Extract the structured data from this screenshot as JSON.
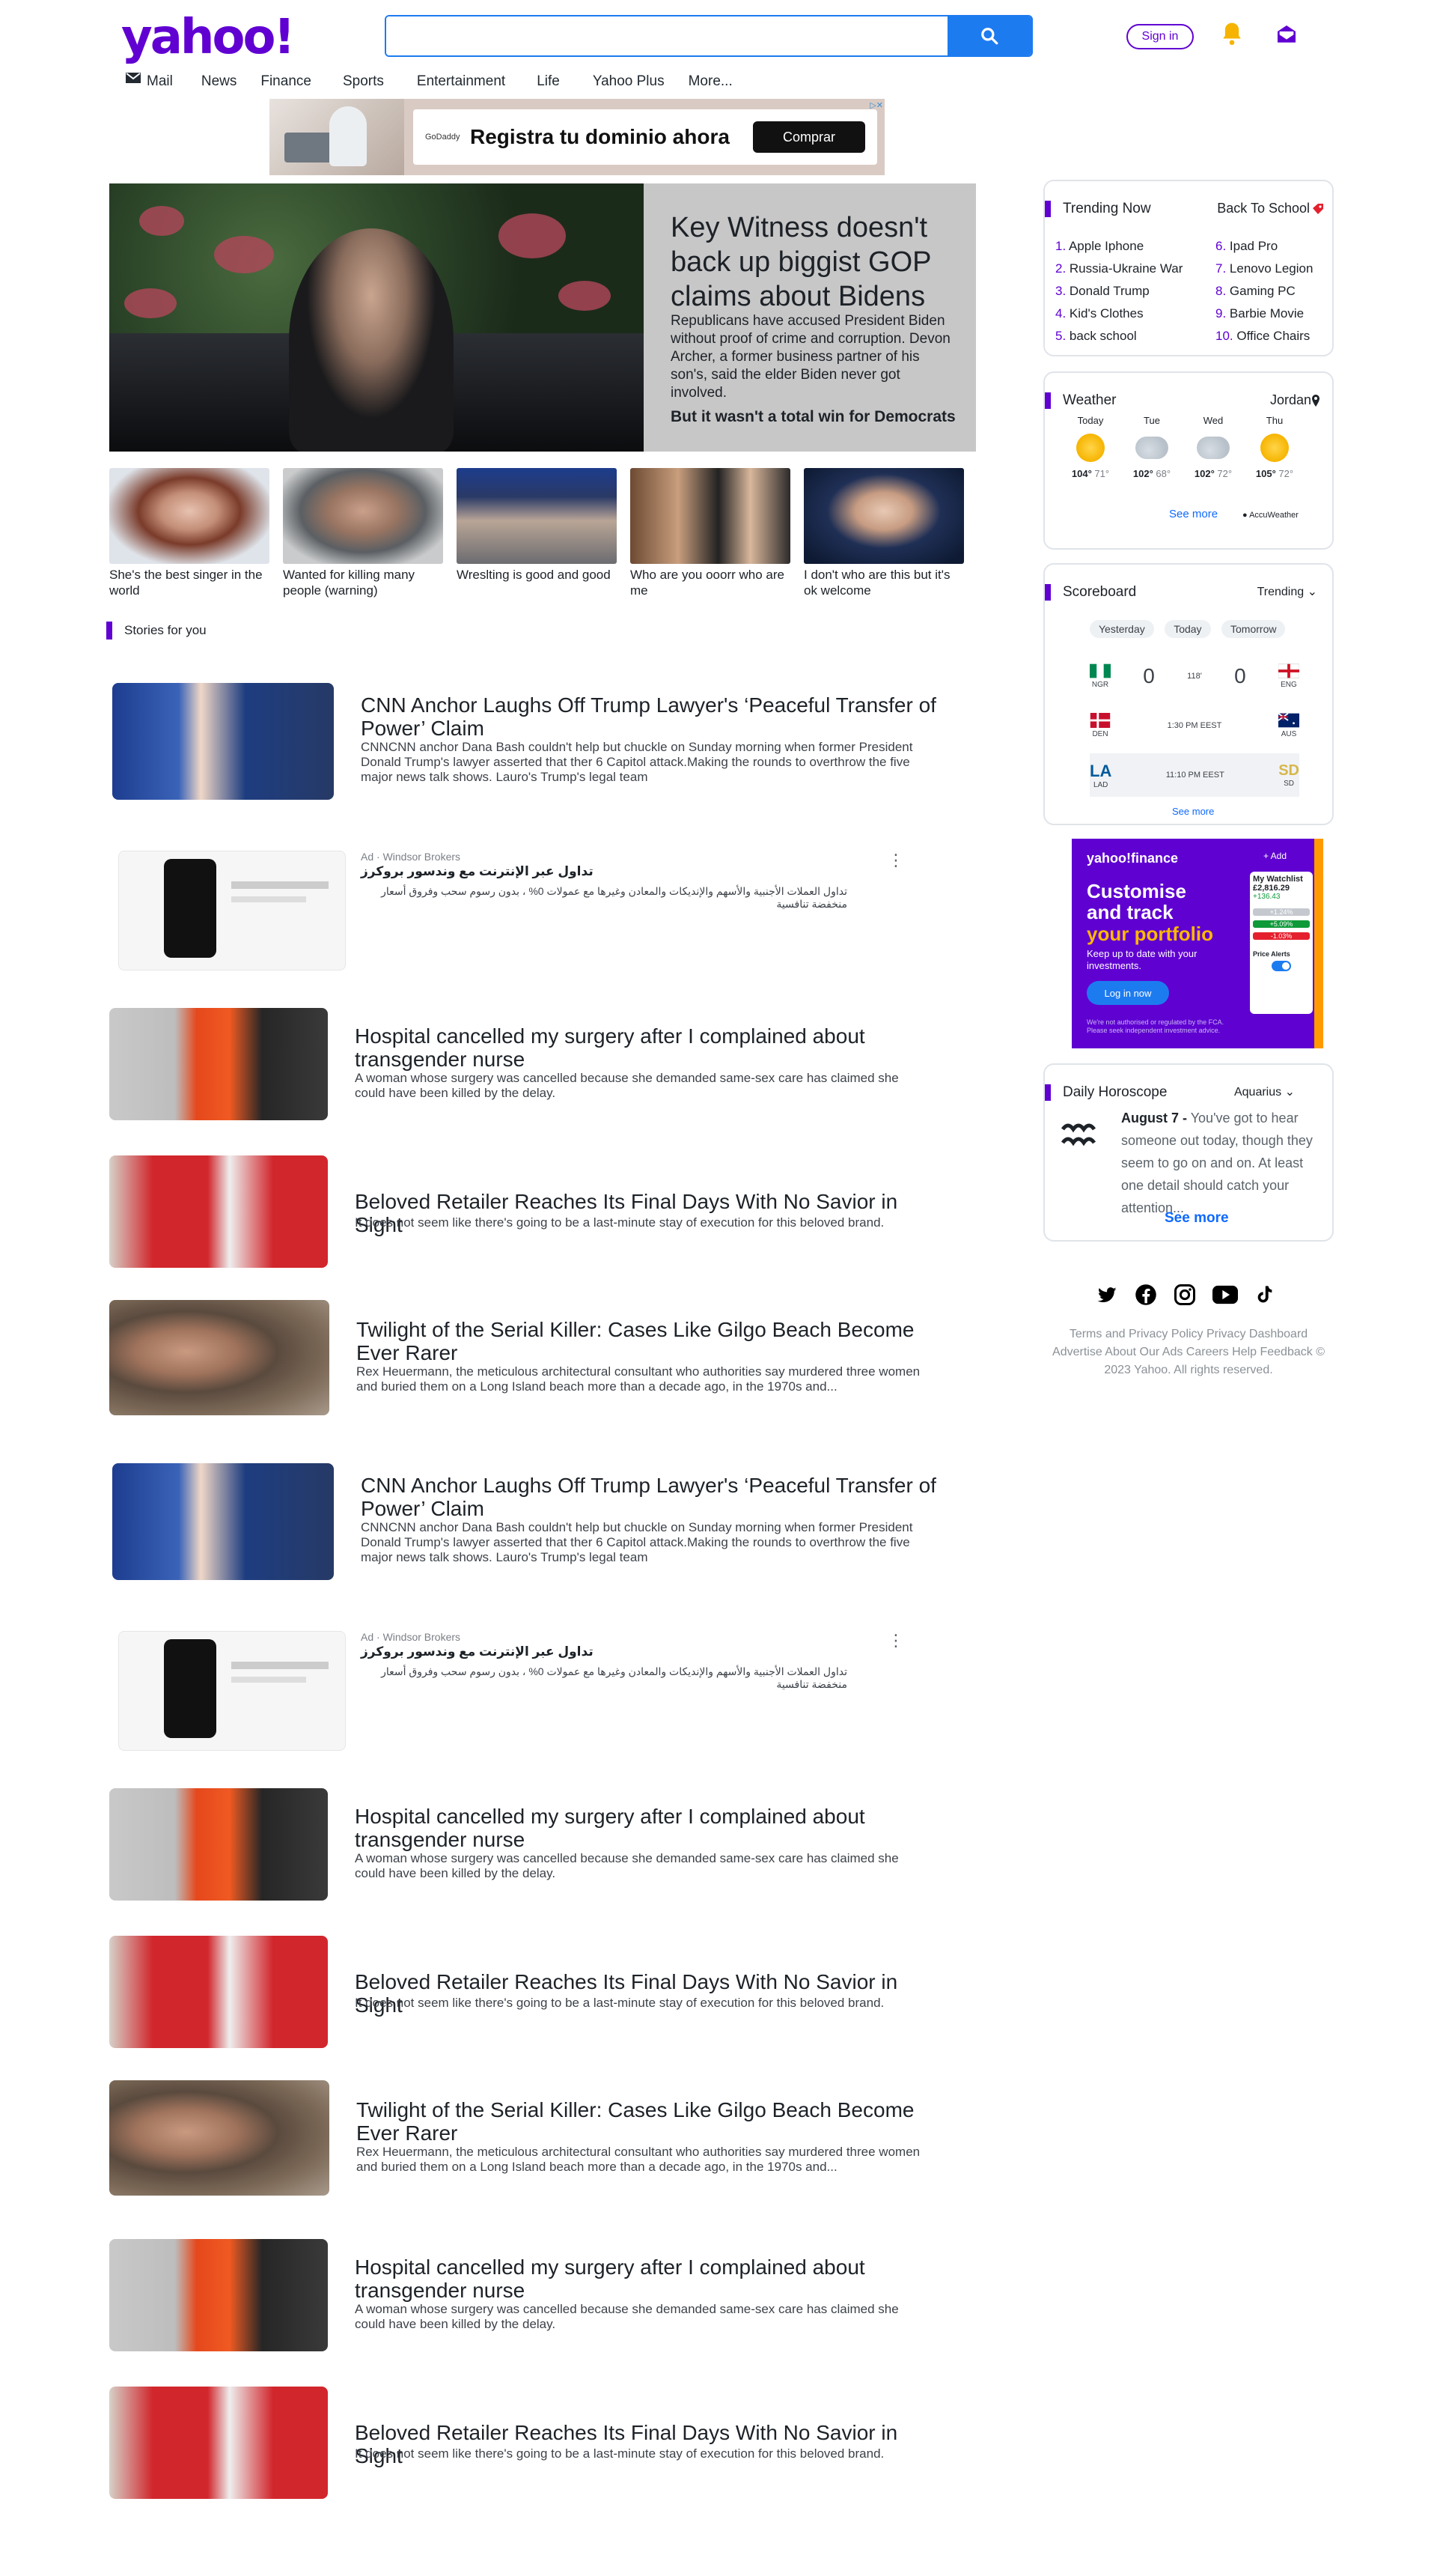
{
  "header": {
    "logo": "yahoo!",
    "search_placeholder": "",
    "signin_label": "Sign in",
    "nav": [
      "Mail",
      "News",
      "Finance",
      "Sports",
      "Entertainment",
      "Life",
      "Yahoo Plus",
      "More..."
    ]
  },
  "ad_banner": {
    "text": "Registra tu dominio ahora",
    "button": "Comprar",
    "brand": "GoDaddy"
  },
  "hero": {
    "title": "Key Witness doesn't back up biggist GOP claims about Bidens",
    "description": "Republicans have accused President Biden without proof of crime and corruption. Devon Archer, a former business partner of his son's, said the elder Biden never got involved.",
    "subhead": "But it wasn't a total win for Democrats"
  },
  "thumbs": [
    {
      "caption": "She's the best singer in the world"
    },
    {
      "caption": "Wanted for killing many people (warning)"
    },
    {
      "caption": "Wreslting is good and good"
    },
    {
      "caption": "Who are you ooorr who are me"
    },
    {
      "caption": "I don't who are this but it's ok welcome"
    }
  ],
  "stories_label": "Stories for you",
  "stories": [
    {
      "kind": "news",
      "title": "CNN Anchor Laughs Off Trump Lawyer's ‘Peaceful Transfer of Power’ Claim",
      "desc": "CNNCNN anchor Dana Bash couldn't help but chuckle on Sunday morning when former President Donald Trump's lawyer asserted that ther 6 Capitol attack.Making the rounds to overthrow the five major news talk shows. Lauro's Trump's legal team"
    },
    {
      "kind": "ad",
      "meta": "Ad · Windsor Brokers",
      "title": "تداول عبر الإنترنت مع وندسور بروكرز",
      "desc": "تداول العملات الأجنبية والأسهم والإنديكات والمعادن وغيرها مع عمولات 0% ، بدون رسوم سحب وفروق أسعار منخفضة تنافسية"
    },
    {
      "kind": "news",
      "title": "Hospital cancelled my surgery after I complained about transgender nurse",
      "desc": "A woman whose surgery was cancelled because she demanded same-sex care has claimed she could have been killed by the delay."
    },
    {
      "kind": "news",
      "title": "Beloved Retailer Reaches Its Final Days With No Savior in Sight",
      "desc": "It does not seem like there's going to be a last-minute stay of execution for this beloved brand."
    },
    {
      "kind": "news",
      "title": "Twilight of the Serial Killer: Cases Like Gilgo Beach Become Ever Rarer",
      "desc": "Rex Heuermann, the meticulous architectural consultant who authorities say murdered three women and buried them on a Long Island beach more than a decade ago, in the 1970s and..."
    },
    {
      "kind": "news",
      "title": "CNN Anchor Laughs Off Trump Lawyer's ‘Peaceful Transfer of Power’ Claim",
      "desc": "CNNCNN anchor Dana Bash couldn't help but chuckle on Sunday morning when former President Donald Trump's lawyer asserted that ther 6 Capitol attack.Making the rounds to overthrow the five major news talk shows. Lauro's Trump's legal team"
    },
    {
      "kind": "ad",
      "meta": "Ad · Windsor Brokers",
      "title": "تداول عبر الإنترنت مع وندسور بروكرز",
      "desc": "تداول العملات الأجنبية والأسهم والإنديكات والمعادن وغيرها مع عمولات 0% ، بدون رسوم سحب وفروق أسعار منخفضة تنافسية"
    },
    {
      "kind": "news",
      "title": "Hospital cancelled my surgery after I complained about transgender nurse",
      "desc": "A woman whose surgery was cancelled because she demanded same-sex care has claimed she could have been killed by the delay."
    },
    {
      "kind": "news",
      "title": "Beloved Retailer Reaches Its Final Days With No Savior in Sight",
      "desc": "It does not seem like there's going to be a last-minute stay of execution for this beloved brand."
    },
    {
      "kind": "news",
      "title": "Twilight of the Serial Killer: Cases Like Gilgo Beach Become Ever Rarer",
      "desc": "Rex Heuermann, the meticulous architectural consultant who authorities say murdered three women and buried them on a Long Island beach more than a decade ago, in the 1970s and..."
    },
    {
      "kind": "news",
      "title": "Hospital cancelled my surgery after I complained about transgender nurse",
      "desc": "A woman whose surgery was cancelled because she demanded same-sex care has claimed she could have been killed by the delay."
    },
    {
      "kind": "news",
      "title": "Beloved Retailer Reaches Its Final Days With No Savior in Sight",
      "desc": "It does not seem like there's going to be a last-minute stay of execution for this beloved brand."
    }
  ],
  "trending": {
    "title": "Trending Now",
    "link": "Back To School",
    "left": [
      "Apple Iphone",
      "Russia-Ukraine War",
      "Donald Trump",
      "Kid's Clothes",
      "back school"
    ],
    "right": [
      "Ipad Pro",
      "Lenovo Legion",
      "Gaming PC",
      "Barbie Movie",
      "Office Chairs"
    ]
  },
  "weather": {
    "title": "Weather",
    "location": "Jordan",
    "days": [
      {
        "name": "Today",
        "hi": "104°",
        "lo": "71°",
        "icon": "sun"
      },
      {
        "name": "Tue",
        "hi": "102°",
        "lo": "68°",
        "icon": "cloud"
      },
      {
        "name": "Wed",
        "hi": "102°",
        "lo": "72°",
        "icon": "cloud"
      },
      {
        "name": "Thu",
        "hi": "105°",
        "lo": "72°",
        "icon": "sun"
      }
    ],
    "see_more": "See more",
    "provider": "AccuWeather"
  },
  "scoreboard": {
    "title": "Scoreboard",
    "filter": "Trending",
    "tabs": [
      "Yesterday",
      "Today",
      "Tomorrow"
    ],
    "rows": [
      {
        "home": "NGR",
        "away": "ENG",
        "home_score": "0",
        "away_score": "0",
        "status": "118'"
      },
      {
        "home": "DEN",
        "away": "AUS",
        "home_score": "",
        "away_score": "",
        "status": "1:30 PM EEST"
      },
      {
        "home": "LAD",
        "away": "SD",
        "home_score": "",
        "away_score": "",
        "status": "11:10 PM EEST"
      }
    ],
    "see_more": "See more"
  },
  "finance_ad": {
    "brand": "yahoo!finance",
    "headline_1": "Customise and track",
    "headline_2": "your portfolio",
    "body": "Keep up to date with your investments.",
    "cta": "Log in now",
    "add": "+ Add",
    "watchlist": "My Watchlist",
    "value": "£2,816.29",
    "change": "+136.43",
    "badges": [
      "+1.24%",
      "+5.09%",
      "-1.03%"
    ],
    "price_alerts": "Price Alerts",
    "disclaimer": "We're not authorised or regulated by the FCA. Please seek independent investment advice."
  },
  "horoscope": {
    "title": "Daily Horoscope",
    "sign": "Aquarius",
    "date": "August 7 -",
    "text": "You've got to hear someone out today, though they seem to go on and on. At least one detail should catch your attention...",
    "see_more": "See more"
  },
  "footer": {
    "links": "Terms and Privacy Policy Privacy Dashboard Advertise About Our Ads Careers Help Feedback © 2023 Yahoo. All rights reserved."
  }
}
